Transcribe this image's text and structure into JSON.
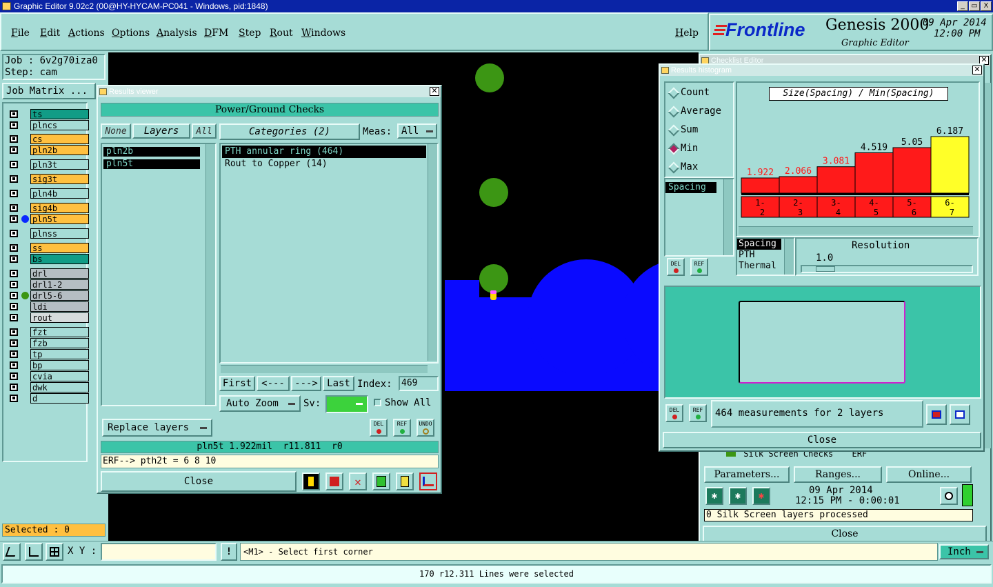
{
  "window": {
    "title": "Graphic Editor 9.02c2 (00@HY-HYCAM-PC041 - Windows, pid:1848)",
    "controls": [
      "_",
      "▭",
      "X"
    ]
  },
  "menu": {
    "items": [
      "File",
      "Edit",
      "Actions",
      "Options",
      "Analysis",
      "DFM",
      "Step",
      "Rout",
      "Windows"
    ],
    "help": "Help"
  },
  "brand": {
    "logo": "Frontline",
    "product": "Genesis 2000",
    "subtitle": "Graphic Editor",
    "date": "09 Apr 2014",
    "time": "12:00 PM"
  },
  "job": {
    "job_label": "Job : 6v2g70iza0",
    "step_label": "Step: cam",
    "matrix_button": "Job Matrix ..."
  },
  "layers": [
    {
      "name": "ts",
      "bg": "#119c86",
      "dot": ""
    },
    {
      "name": "plncs",
      "bg": "#a6dcd6",
      "dot": ""
    },
    {
      "name": "cs",
      "bg": "#ffc040",
      "dot": ""
    },
    {
      "name": "pln2b",
      "bg": "#ffc040",
      "dot": ""
    },
    {
      "name": "pln3t",
      "bg": "#a6dcd6",
      "dot": ""
    },
    {
      "name": "sig3t",
      "bg": "#ffc040",
      "dot": ""
    },
    {
      "name": "pln4b",
      "bg": "#a6dcd6",
      "dot": ""
    },
    {
      "name": "sig4b",
      "bg": "#ffc040",
      "dot": ""
    },
    {
      "name": "pln5t",
      "bg": "#ffc040",
      "dot": "#0a28ff"
    },
    {
      "name": "plnss",
      "bg": "#a6dcd6",
      "dot": ""
    },
    {
      "name": "ss",
      "bg": "#ffc040",
      "dot": ""
    },
    {
      "name": "bs",
      "bg": "#119c86",
      "dot": ""
    },
    {
      "name": "drl",
      "bg": "#b5bec3",
      "dot": ""
    },
    {
      "name": "drl1-2",
      "bg": "#b5bec3",
      "dot": ""
    },
    {
      "name": "drl5-6",
      "bg": "#b5bec3",
      "dot": "#3c9614"
    },
    {
      "name": "ldi",
      "bg": "#b5bec3",
      "dot": ""
    },
    {
      "name": "rout",
      "bg": "#d6dcdc",
      "dot": ""
    },
    {
      "name": "fzt",
      "bg": "#a6dcd6",
      "dot": ""
    },
    {
      "name": "fzb",
      "bg": "#a6dcd6",
      "dot": ""
    },
    {
      "name": "tp",
      "bg": "#a6dcd6",
      "dot": ""
    },
    {
      "name": "bp",
      "bg": "#a6dcd6",
      "dot": ""
    },
    {
      "name": "cvia",
      "bg": "#a6dcd6",
      "dot": ""
    },
    {
      "name": "dwk",
      "bg": "#a6dcd6",
      "dot": ""
    },
    {
      "name": "d",
      "bg": "#a6dcd6",
      "dot": ""
    }
  ],
  "selected": "Selected : 0",
  "results_viewer": {
    "title": "Results viewer",
    "header": "Power/Ground Checks",
    "none": "None",
    "layers_tab": "Layers",
    "all": "All",
    "categories": "Categories (2)",
    "meas_label": "Meas:",
    "meas_value": "All",
    "layer_list": [
      "pln2b",
      "pln5t"
    ],
    "category_list": [
      "PTH annular ring (464)",
      "Rout to Copper (14)"
    ],
    "nav": {
      "first": "First",
      "prev": "<---",
      "next": "--->",
      "last": "Last",
      "index_label": "Index:",
      "index_value": "469"
    },
    "auto_zoom": "Auto Zoom",
    "sv_label": "Sv:",
    "show_all": "Show All",
    "replace_layers": "Replace layers",
    "icons": {
      "del": "DEL",
      "ref": "REF",
      "undo": "UNDO"
    },
    "status": "pln5t 1.922mil  r11.811  r0",
    "erf": "ERF--> pth2t = 6 8 10",
    "close": "Close"
  },
  "checklist": {
    "title": "Checklist Editor",
    "row_text": "Silk Screen Checks",
    "erf_label": "ERF",
    "parameters": "Parameters...",
    "ranges": "Ranges...",
    "online": "Online...",
    "date": "09 Apr 2014",
    "time": "12:15 PM - 0:00:01",
    "status": "0 Silk Screen layers processed",
    "close": "Close"
  },
  "histogram": {
    "title": "Results histogram",
    "modes": [
      "Count",
      "Average",
      "Sum",
      "Min",
      "Max"
    ],
    "selected_mode": "Min",
    "chart_title": "Size(Spacing) / Min(Spacing)",
    "left_list": [
      "Spacing"
    ],
    "right_list": [
      "Spacing",
      "PTH",
      "Thermal"
    ],
    "resolution_label": "Resolution",
    "resolution_value": "1.0",
    "measurements": "464 measurements for 2 layers",
    "del": "DEL",
    "ref": "REF",
    "close": "Close",
    "colors": {
      "bar": "#ff1a1a",
      "highlight": "#ffff28"
    }
  },
  "chart_data": {
    "type": "bar",
    "title": "Size(Spacing) / Min(Spacing)",
    "categories": [
      "1-2",
      "2-3",
      "3-4",
      "4-5",
      "5-6",
      "6-7"
    ],
    "values": [
      1.922,
      2.066,
      3.081,
      4.519,
      5.05,
      6.187
    ],
    "value_labels": [
      "1.922",
      "2.066",
      "3.081",
      "4.519",
      "5.05",
      "6.187"
    ],
    "highlighted": "6-7"
  },
  "bottom": {
    "xy_label": "X Y :",
    "xy_value": "",
    "bang": "!",
    "prompt": "<M1> - Select first corner",
    "units": "Inch",
    "status": "170 r12.311 Lines were selected"
  }
}
